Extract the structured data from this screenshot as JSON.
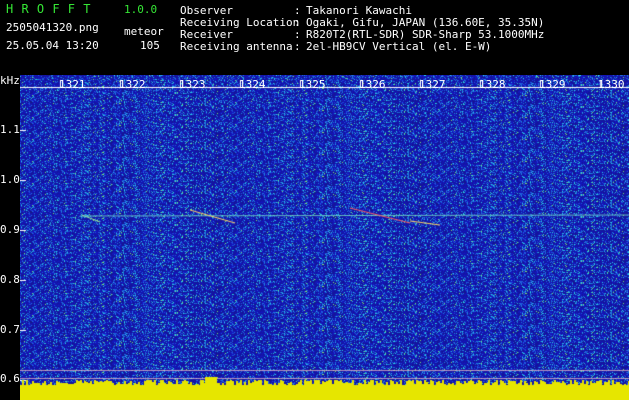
{
  "app": {
    "title": "H R O F F T",
    "version": "1.0.0"
  },
  "file": {
    "name": "2505041320.png",
    "datetime": "25.05.04 13:20",
    "mode_label": "meteor",
    "mode_value": "105"
  },
  "info": {
    "labels": [
      "Observer",
      "Receiving Location",
      "Receiver",
      "Receiving antenna"
    ],
    "values": [
      "Takanori Kawachi",
      "Ogaki, Gifu, JAPAN (136.60E, 35.35N)",
      "R820T2(RTL-SDR) SDR-Sharp 53.1000MHz",
      "2el-HB9CV Vertical (el. E-W)"
    ]
  },
  "axis": {
    "unit": "kHz",
    "time_ticks": [
      "1321",
      "1322",
      "1323",
      "1324",
      "1325",
      "1326",
      "1327",
      "1328",
      "1329",
      "1330"
    ],
    "freq_ticks": [
      "1.1",
      "1.0",
      "0.9",
      "0.8",
      "0.7",
      "0.6"
    ]
  },
  "colors": {
    "background": "#1a1a9a",
    "label_green": "#35e635",
    "header": "#000000",
    "bottom_band": "#e6e600"
  }
}
